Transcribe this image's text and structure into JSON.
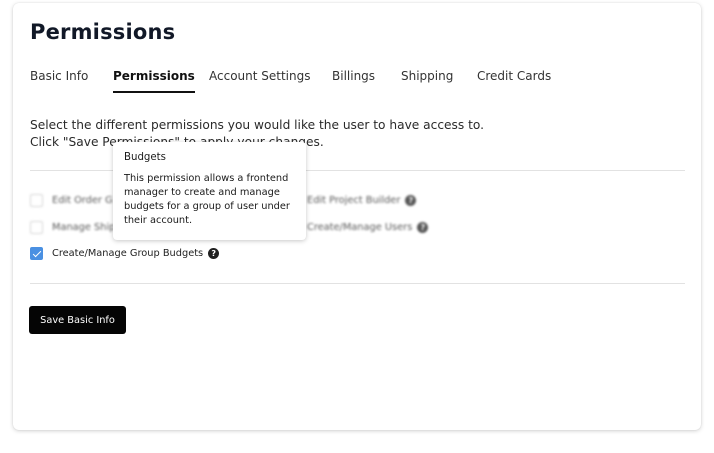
{
  "page": {
    "title": "Permissions"
  },
  "tabs": [
    {
      "label": "Basic Info",
      "active": false
    },
    {
      "label": "Permissions",
      "active": true
    },
    {
      "label": "Account Settings",
      "active": false
    },
    {
      "label": "Billings",
      "active": false
    },
    {
      "label": "Shipping",
      "active": false
    },
    {
      "label": "Credit Cards",
      "active": false
    }
  ],
  "description": {
    "line1": "Select the different permissions you would like the user to have access to.",
    "line2": "Click \"Save Permissions\" to apply your changes."
  },
  "permissions": [
    {
      "label": "Edit Order G",
      "checked": false
    },
    {
      "label": "Edit Project Builder",
      "checked": false
    },
    {
      "label": "Manage Ship",
      "checked": false
    },
    {
      "label": "Create/Manage Users",
      "checked": false
    },
    {
      "label": "Create/Manage Group Budgets",
      "checked": true
    }
  ],
  "help_glyph": "?",
  "save_button": {
    "label": "Save Basic Info"
  },
  "tooltip": {
    "title": "Budgets",
    "body_lines": [
      "This permission allows a frontend",
      "manager to create and manage",
      "budgets for a group of user under",
      "their account."
    ]
  },
  "colors": {
    "accent_checkbox": "#4a90e2",
    "button_bg": "#050505",
    "title": "#111827"
  }
}
